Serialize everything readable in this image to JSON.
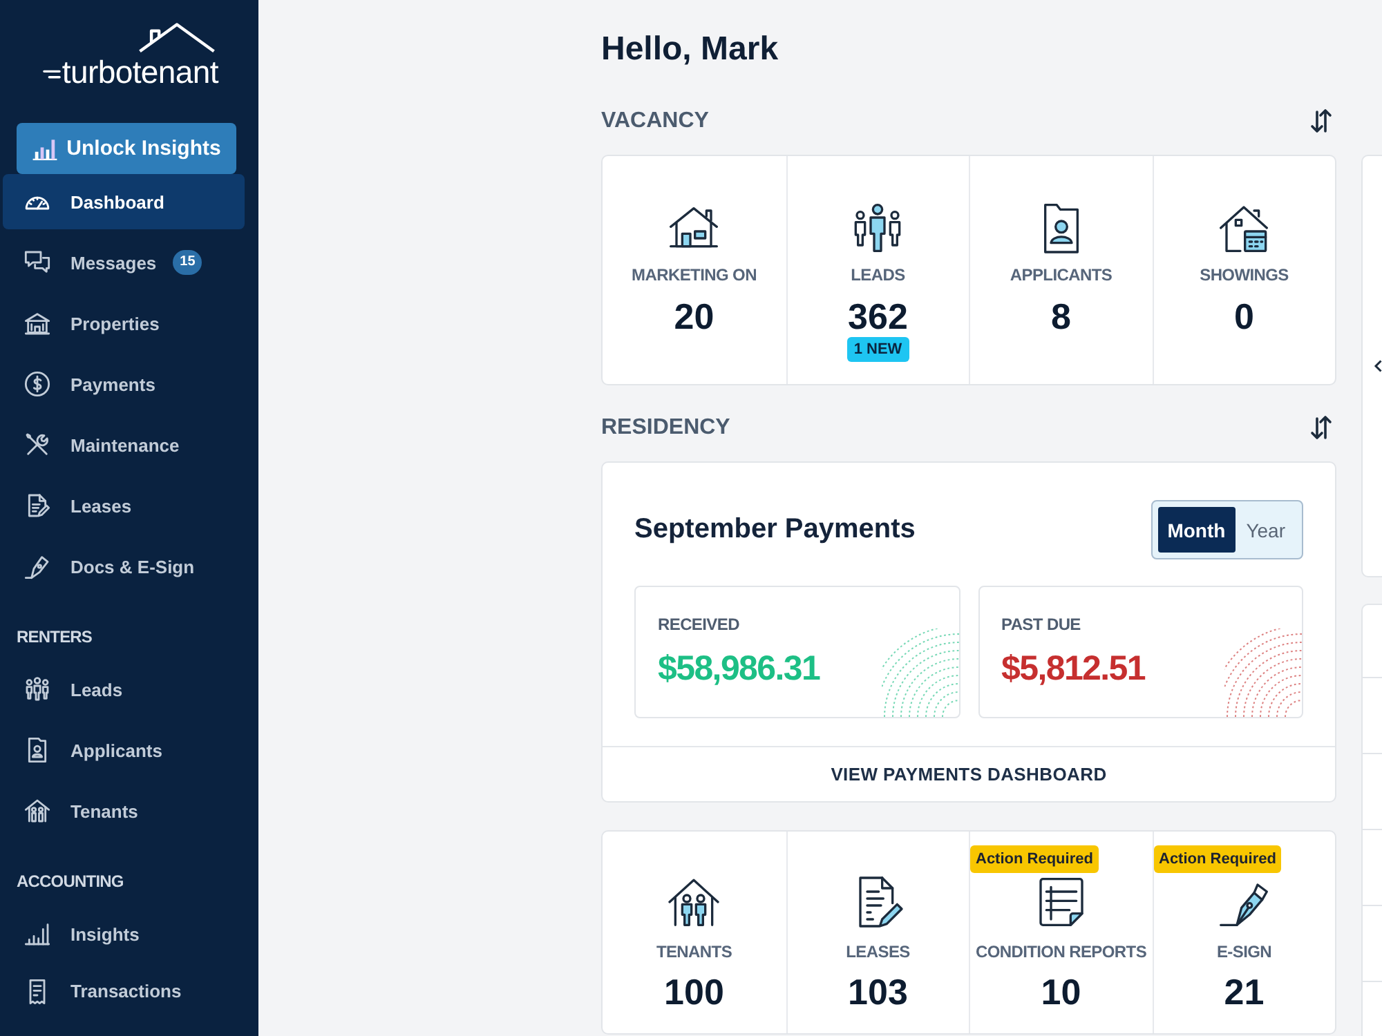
{
  "sidebar": {
    "logo": "turbotenant",
    "upgrade_button": "Unlock Insights",
    "sections": [
      {
        "items": [
          {
            "label": "Dashboard",
            "selected": true
          },
          {
            "label": "Messages",
            "selected": false,
            "badge": "15"
          },
          {
            "label": "Properties",
            "selected": false
          },
          {
            "label": "Payments",
            "selected": false
          },
          {
            "label": "Maintenance",
            "selected": false
          },
          {
            "label": "Leases",
            "selected": false
          },
          {
            "label": "Docs & E-Sign",
            "selected": false
          }
        ]
      },
      {
        "heading": "RENTERS",
        "items": [
          {
            "label": "Leads",
            "selected": false
          },
          {
            "label": "Applicants",
            "selected": false
          },
          {
            "label": "Tenants",
            "selected": false
          }
        ]
      },
      {
        "heading": "ACCOUNTING",
        "items": [
          {
            "label": "Insights",
            "selected": false
          },
          {
            "label": "Transactions",
            "selected": false
          }
        ]
      }
    ]
  },
  "greeting": "Hello, Mark",
  "vacancy": {
    "title": "VACANCY",
    "stats": [
      {
        "label": "MARKETING ON",
        "value": "20"
      },
      {
        "label": "LEADS",
        "value": "362",
        "badge": "1 NEW"
      },
      {
        "label": "APPLICANTS",
        "value": "8"
      },
      {
        "label": "SHOWINGS",
        "value": "0"
      }
    ]
  },
  "residency": {
    "title": "RESIDENCY",
    "payments": {
      "title": "September Payments",
      "periods": [
        {
          "label": "Month",
          "selected": true
        },
        {
          "label": "Year",
          "selected": false
        }
      ],
      "tiles": [
        {
          "label": "RECEIVED",
          "amount": "$58,986.31",
          "color": "#1dbf85"
        },
        {
          "label": "PAST DUE",
          "amount": "$5,812.51",
          "color": "#c62f2f"
        }
      ],
      "link": "VIEW PAYMENTS DASHBOARD"
    },
    "stats": [
      {
        "label": "TENANTS",
        "value": "100"
      },
      {
        "label": "LEASES",
        "value": "103"
      },
      {
        "label": "CONDITION REPORTS",
        "value": "10",
        "flag": "Action Required"
      },
      {
        "label": "E-SIGN",
        "value": "21",
        "flag": "Action Required"
      }
    ]
  }
}
